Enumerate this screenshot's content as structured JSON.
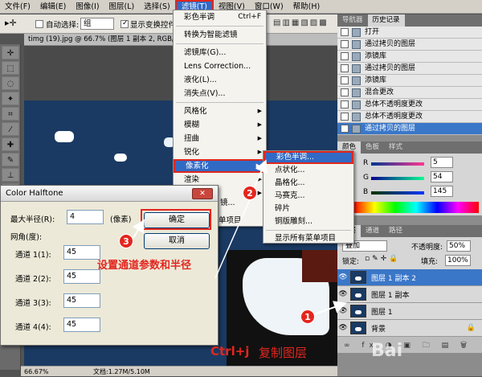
{
  "menubar": {
    "items": [
      "文件(F)",
      "编辑(E)",
      "图像(I)",
      "图层(L)",
      "选择(S)",
      "滤镜(T)",
      "视图(V)",
      "窗口(W)",
      "帮助(H)"
    ],
    "active_index": 5
  },
  "options_bar": {
    "auto_select_label": "自动选择:",
    "auto_select_value": "组",
    "show_transform_label": "显示变换控件"
  },
  "document": {
    "tab_title": "timg (19).jpg @ 66.7% (图层 1 副本 2, RGB/8",
    "zoom": "66.67%",
    "doc_info": "文档:1.27M/5.10M"
  },
  "filter_menu": {
    "items": [
      {
        "label": "彩色半调",
        "shortcut": "Ctrl+F"
      },
      {
        "sep": true
      },
      {
        "label": "转换为智能滤镜"
      },
      {
        "sep": true
      },
      {
        "label": "滤镜库(G)..."
      },
      {
        "label": "Lens Correction..."
      },
      {
        "label": "液化(L)..."
      },
      {
        "label": "消失点(V)..."
      },
      {
        "sep": true
      },
      {
        "label": "风格化",
        "arrow": true
      },
      {
        "label": "模糊",
        "arrow": true
      },
      {
        "label": "扭曲",
        "arrow": true
      },
      {
        "label": "锐化",
        "arrow": true
      },
      {
        "label": "像素化",
        "arrow": true,
        "highlight": true
      },
      {
        "label": "渲染",
        "arrow": true
      },
      {
        "label": "杂色",
        "arrow": true
      }
    ]
  },
  "pixelate_submenu": {
    "items": [
      {
        "label": "彩色半调...",
        "highlight": true
      },
      {
        "label": "点状化..."
      },
      {
        "label": "晶格化..."
      },
      {
        "label": "马赛克..."
      },
      {
        "label": "碎片"
      },
      {
        "label": "铜版雕刻..."
      },
      {
        "sep": true
      },
      {
        "label": "显示所有菜单项目"
      }
    ]
  },
  "hidden_menu_fragments": {
    "a": "镜...",
    "b": "单项目"
  },
  "dialog": {
    "title": "Color Halftone",
    "max_radius_label": "最大半径(R):",
    "max_radius_value": "4",
    "max_radius_unit": "(像素)",
    "angle_group_label": "网角(度):",
    "channels": [
      {
        "label": "通道 1(1):",
        "value": "45"
      },
      {
        "label": "通道 2(2):",
        "value": "45"
      },
      {
        "label": "通道 3(3):",
        "value": "45"
      },
      {
        "label": "通道 4(4):",
        "value": "45"
      }
    ],
    "ok_label": "确定",
    "cancel_label": "取消"
  },
  "history_panel": {
    "tabs": [
      "导航器",
      "历史记录"
    ],
    "active_tab": 1,
    "rows": [
      "打开",
      "通过拷贝的图层",
      "添镜库",
      "通过拷贝的图层",
      "添镜库",
      "混合更改",
      "总体不透明度更改",
      "总体不透明度更改",
      "通过拷贝的图层"
    ],
    "selected_index": 8
  },
  "color_panel": {
    "tabs": [
      "颜色",
      "色板",
      "样式"
    ],
    "active_tab": 0,
    "channels": [
      {
        "label": "R",
        "value": "5"
      },
      {
        "label": "G",
        "value": "54"
      },
      {
        "label": "B",
        "value": "145"
      }
    ]
  },
  "layers_panel": {
    "tabs": [
      "图层",
      "通道",
      "路径"
    ],
    "active_tab": 0,
    "blend_mode": "叠加",
    "opacity_label": "不透明度:",
    "opacity_value": "50%",
    "lock_label": "锁定:",
    "fill_label": "填充:",
    "fill_value": "100%",
    "layers": [
      {
        "name": "图层 1 副本 2",
        "selected": true
      },
      {
        "name": "图层 1 副本",
        "selected": false
      },
      {
        "name": "图层 1",
        "selected": false
      },
      {
        "name": "背景",
        "selected": false
      }
    ]
  },
  "annotations": {
    "badge_1": "1",
    "badge_2": "2",
    "badge_3": "3",
    "step_params": "设置通道参数和半径",
    "step_copy_hotkey": "Ctrl+j",
    "step_copy_text": "复制图层",
    "accent_color": "#e3261e",
    "watermark": "Bai"
  },
  "colors": {
    "selection_blue": "#3a77c8",
    "menu_blue": "#316ac5",
    "canvas_blue": "#1a3a63"
  }
}
